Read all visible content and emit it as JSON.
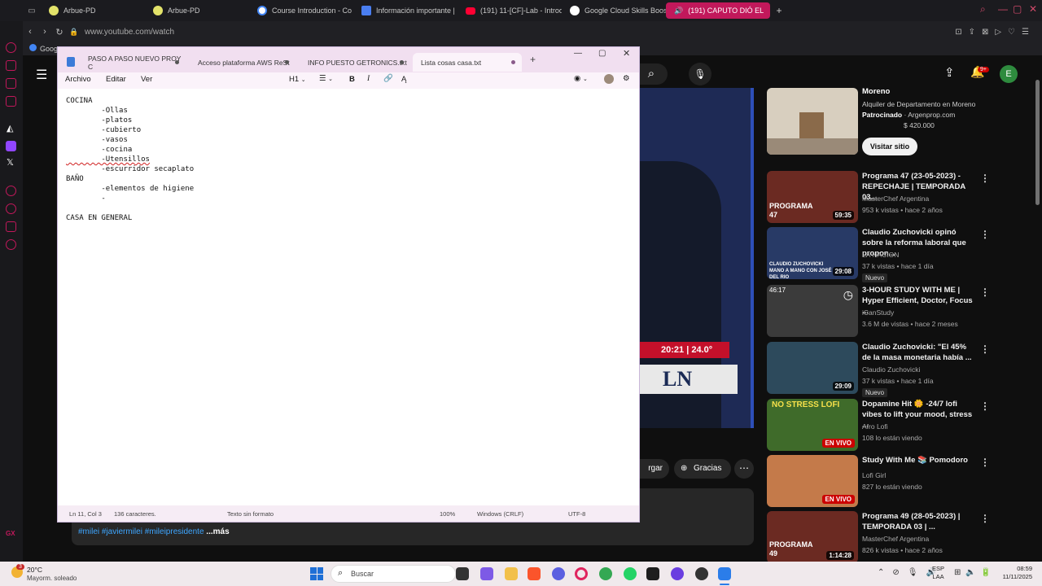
{
  "browser": {
    "tabs": [
      {
        "label": "Arbue-PD"
      },
      {
        "label": "Arbue-PD"
      },
      {
        "label": "Course Introduction - Co"
      },
      {
        "label": "Información importante |"
      },
      {
        "label": "(191) 11-[CF]-Lab - Introd"
      },
      {
        "label": "Google Cloud Skills Boost"
      },
      {
        "label": "(191) CAPUTO DIÓ EL"
      }
    ],
    "url": "www.youtube.com/watch",
    "bookmark": "Goog"
  },
  "notepad": {
    "tabs": [
      {
        "label": "PASO A PASO NUEVO PROY C"
      },
      {
        "label": "Acceso plataforma AWS ReSt"
      },
      {
        "label": "INFO PUESTO GETRONICS.txt"
      },
      {
        "label": "Lista cosas casa.txt"
      }
    ],
    "menu": {
      "file": "Archivo",
      "edit": "Editar",
      "view": "Ver",
      "heading": "H1"
    },
    "lines": [
      "COCINA",
      "        -Ollas",
      "        -platos",
      "        -cubierto",
      "        -vasos",
      "        -cocina",
      "        -Utensillos",
      "        -escurridor secaplato",
      "BAÑO",
      "        -elementos de higiene",
      "        -",
      "",
      "CASA EN GENERAL"
    ],
    "status": {
      "position": "Ln 11, Col 3",
      "chars": "136 caracteres.",
      "format": "Texto sin formato",
      "zoom": "100%",
      "eol": "Windows (CRLF)",
      "encoding": "UTF-8"
    }
  },
  "youtube": {
    "top_ad": {
      "title": "Moreno",
      "desc": "Alquiler de Departamento en Moreno",
      "sponsored": "Patrocinado",
      "domain": "Argenprop.com",
      "price": "$ 420.000",
      "cta": "Visitar sitio"
    },
    "notif_count": "9+",
    "avatar": "E",
    "overlay_clock": "20:21 | 24.0°",
    "overlay_logo": "LN",
    "hashtags": "#milei #javiermilei #mileipresidente",
    "more": "...más",
    "partial_button": "rgar",
    "thanks_button": "Gracias",
    "recommendations": [
      {
        "title": "Programa 47 (23-05-2023) - REPECHAJE | TEMPORADA 03...",
        "channel": "MasterChef Argentina",
        "meta": "953 k vistas • hace 2 años",
        "duration": "59:35",
        "overlay": "PROGRAMA 47",
        "color": "#6b2a22"
      },
      {
        "title": "Claudio Zuchovicki opinó sobre la reforma laboral que propon...",
        "channel": "LA NACION",
        "meta": "37 k vistas • hace 1 día",
        "duration": "29:08",
        "badge": "Nuevo",
        "overlay": "CLAUDIO ZUCHOVICKI MANO A MANO CON JOSÉ DEL RIO",
        "color": "#283a66"
      },
      {
        "title": "3-HOUR STUDY WITH ME | Hyper Efficient, Doctor, Focus ...",
        "channel": "iCanStudy",
        "meta": "3.6 M de vistas • hace 2 meses",
        "top_left": "46:17",
        "color": "#3b3b3b"
      },
      {
        "title": "Claudio Zuchovicki: \"El 45% de la masa monetaria había ...",
        "channel": "Claudio Zuchovicki",
        "meta": "37 k vistas • hace 1 día",
        "duration": "29:09",
        "badge": "Nuevo",
        "color": "#2d4a5c"
      },
      {
        "title": "Dopamine Hit 🌼 -24/7 lofi vibes to lift your mood, stress ...",
        "channel": "Afro Lofi",
        "meta": "108 lo están viendo",
        "live": "EN VIVO",
        "overlay": "NO STRESS LOFI",
        "color": "#3f6b2a"
      },
      {
        "title": "Study With Me 📚 Pomodoro",
        "channel": "Lofi Girl",
        "meta": "827 lo están viendo",
        "live": "EN VIVO",
        "color": "#c47a4a"
      },
      {
        "title": "Programa 49 (28-05-2023) | TEMPORADA 03 | ...",
        "channel": "MasterChef Argentina",
        "meta": "826 k vistas • hace 2 años",
        "duration": "1:14:28",
        "overlay": "PROGRAMA 49",
        "color": "#6b2a22"
      }
    ]
  },
  "taskbar": {
    "weather_temp": "20°C",
    "weather_desc": "Mayorm. soleado",
    "weather_badge": "3",
    "search": "Buscar",
    "lang": "ESP",
    "lang2": "LAA",
    "time": "08:59",
    "date": "11/11/2025"
  }
}
